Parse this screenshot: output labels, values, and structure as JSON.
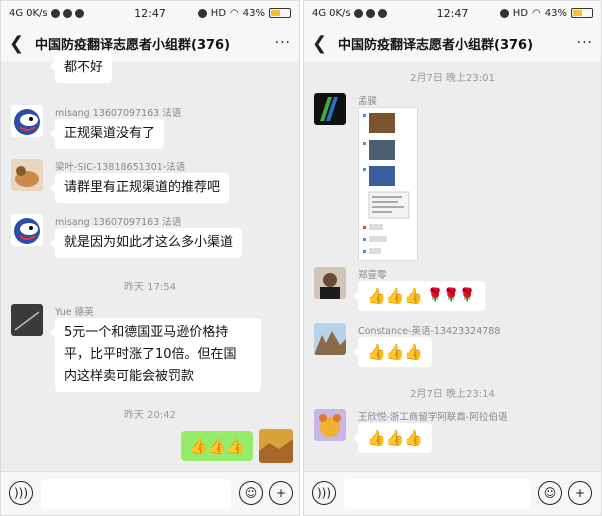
{
  "status": {
    "net": "4G",
    "speed": "0K/s",
    "time": "12:47",
    "hd": "HD",
    "battery": "43%"
  },
  "header": {
    "title": "中国防疫翻译志愿者小组群(376)",
    "more": "···"
  },
  "left_chat": {
    "partial_text": "都不好",
    "msg1": {
      "sender": "misang 13607097163 法语",
      "text": "正规渠道没有了"
    },
    "msg2": {
      "sender": "梁叶-SIC-13818651301-法语",
      "text": "请群里有正规渠道的推荐吧"
    },
    "msg3": {
      "sender": "misang 13607097163 法语",
      "text": "就是因为如此才这么多小渠道"
    },
    "ts1": "昨天 17:54",
    "msg4": {
      "sender": "Yue 德英",
      "line1": "5元一个和德国亚马逊价格持",
      "line2": "平，比平时涨了10倍。但在国",
      "line3": "内这样卖可能会被罚款"
    },
    "ts2": "昨天 20:42",
    "self_emoji": "👍👍👍"
  },
  "right_chat": {
    "ts1": "2月7日 晚上23:01",
    "msg1": {
      "sender": "孟骏"
    },
    "msg2": {
      "sender": "郑壹零",
      "emoji": "👍👍👍",
      "roses": "🌹🌹🌹"
    },
    "msg3": {
      "sender": "Constance-英语-13423324788",
      "emoji": "👍👍👍"
    },
    "ts2": "2月7日 晚上23:14",
    "msg4": {
      "sender": "王欣悦-浙工商留学阿联酋-阿拉伯语",
      "emoji": "👍👍👍"
    }
  },
  "icons": {
    "voice": "voice-icon",
    "emoji": "emoji-icon",
    "plus": "plus-icon",
    "back": "back-arrow-icon"
  },
  "colors": {
    "self_bubble": "#95ec69",
    "background": "#ededed"
  }
}
